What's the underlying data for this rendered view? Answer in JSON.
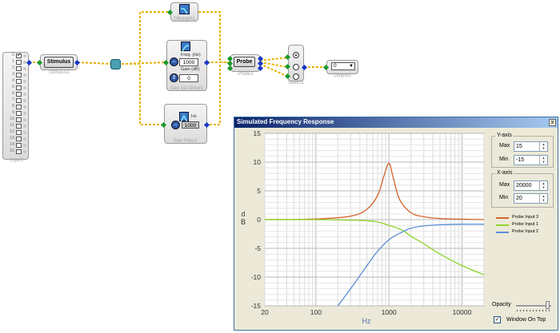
{
  "input_block": {
    "channels": [
      "0",
      "1",
      "2",
      "3",
      "4",
      "5",
      "6",
      "7",
      "8",
      "9",
      "10",
      "11",
      "12",
      "13",
      "14",
      "15"
    ],
    "checked_index": 0,
    "label": "Input1"
  },
  "stimulus_block": {
    "button": "Stimulus",
    "label": "Stimulus1"
  },
  "db_block": {
    "label": "DBgraph1"
  },
  "gen1st_block": {
    "freq_label": "Freq. (Hz)",
    "freq_value": "1000",
    "gain_label": "Gain (dB)",
    "gain_value": "0",
    "label": "Gen 1st Order1"
  },
  "genfilt_block": {
    "hz_label": "Hz",
    "hz_value": "1000",
    "label": "Gen Filter1"
  },
  "probe_block": {
    "button": "Probe",
    "label": "Probe1"
  },
  "select_block": {
    "label": "Select1"
  },
  "output_block": {
    "value": "0",
    "label": "Output1"
  },
  "freq_window": {
    "title": "Simulated Frequency Response",
    "close": "x",
    "yaxis_title": "Y-axis",
    "y_max_label": "Max",
    "y_max": "15",
    "y_min_label": "Min",
    "y_min": "-15",
    "xaxis_title": "X-axis",
    "x_max_label": "Max",
    "x_max": "20000",
    "x_min_label": "Min",
    "x_min": "20",
    "opacity_label": "Opacity",
    "on_top_label": "Window On Top",
    "on_top_check": "✓",
    "unit_d": "d",
    "unit_b": "B"
  },
  "chart_data": {
    "type": "line",
    "xscale": "log",
    "xlim": [
      20,
      20000
    ],
    "ylim": [
      -15,
      15
    ],
    "xlabel": "Hz",
    "ylabel": "dB",
    "xticks": [
      "20",
      "100",
      "1000",
      "10000"
    ],
    "yticks": [
      "15",
      "10",
      "5",
      "0",
      "-5",
      "-10",
      "-15"
    ],
    "grid": true,
    "legend_position": "right",
    "series": [
      {
        "name": "Probe Input 3",
        "color": "#d4632b",
        "x": [
          20,
          100,
          300,
          500,
          700,
          850,
          1000,
          1150,
          1400,
          2000,
          3000,
          5000,
          20000
        ],
        "y": [
          0,
          0.1,
          0.6,
          1.8,
          4.2,
          7.5,
          9.8,
          7.2,
          3.5,
          1.2,
          0.5,
          0.2,
          0
        ]
      },
      {
        "name": "Probe Input 1",
        "color": "#8fd42e",
        "x": [
          20,
          100,
          300,
          500,
          700,
          1000,
          1500,
          2000,
          3000,
          5000,
          10000,
          20000
        ],
        "y": [
          0,
          0,
          -0.1,
          -0.2,
          -0.4,
          -1.0,
          -1.8,
          -2.9,
          -4.2,
          -6.0,
          -8.0,
          -9.6
        ]
      },
      {
        "name": "Probe Input 2",
        "color": "#5b8fd6",
        "x": [
          200,
          300,
          500,
          700,
          1000,
          1500,
          2000,
          3000,
          5000,
          10000,
          20000
        ],
        "y": [
          -15,
          -12,
          -8,
          -5.5,
          -3.5,
          -2.2,
          -1.5,
          -1.1,
          -0.9,
          -0.8,
          -0.8
        ]
      }
    ]
  }
}
